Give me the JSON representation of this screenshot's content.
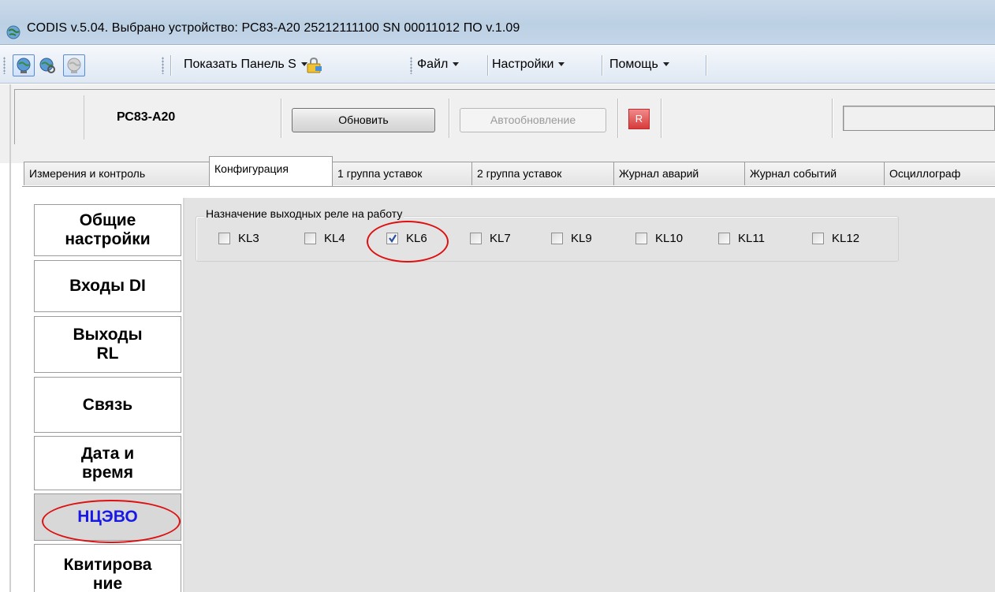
{
  "window": {
    "title": "CODIS v.5.04.  Выбрано устройство:  РС83-А20  25212111100  SN 00011012  ПО v.1.09"
  },
  "toolbar": {
    "show_panel_label": "Показать Панель S",
    "menu_file": "Файл",
    "menu_settings": "Настройки",
    "menu_help": "Помощь"
  },
  "device_bar": {
    "device_name": "РС83-А20",
    "refresh_button": "Обновить",
    "auto_refresh_button": "Автообновление",
    "indicator_label": "R",
    "indicator_color": "#d83b3b"
  },
  "tabs": [
    {
      "label": "Измерения и контроль"
    },
    {
      "label": "Конфигурация",
      "selected": true
    },
    {
      "label": "1 группа уставок"
    },
    {
      "label": "2 группа уставок"
    },
    {
      "label": "Журнал аварий"
    },
    {
      "label": "Журнал событий"
    },
    {
      "label": "Осциллограф"
    }
  ],
  "sidebar": {
    "items": [
      {
        "label": "Общие\nнастройки"
      },
      {
        "label": "Входы DI"
      },
      {
        "label": "Выходы\nRL"
      },
      {
        "label": "Связь"
      },
      {
        "label": "Дата и\nвремя"
      },
      {
        "label": "НЦЭВО",
        "selected": true
      },
      {
        "label": "Квитирова\nние"
      }
    ]
  },
  "relay_group": {
    "title": "Назначение выходных реле на работу",
    "relays": [
      {
        "label": "KL3",
        "checked": false
      },
      {
        "label": "KL4",
        "checked": false
      },
      {
        "label": "KL6",
        "checked": true
      },
      {
        "label": "KL7",
        "checked": false
      },
      {
        "label": "KL9",
        "checked": false
      },
      {
        "label": "KL10",
        "checked": false
      },
      {
        "label": "KL11",
        "checked": false
      },
      {
        "label": "KL12",
        "checked": false
      }
    ]
  },
  "colors": {
    "selected_nav_text": "#1919e6",
    "annotation": "#dd1111"
  }
}
